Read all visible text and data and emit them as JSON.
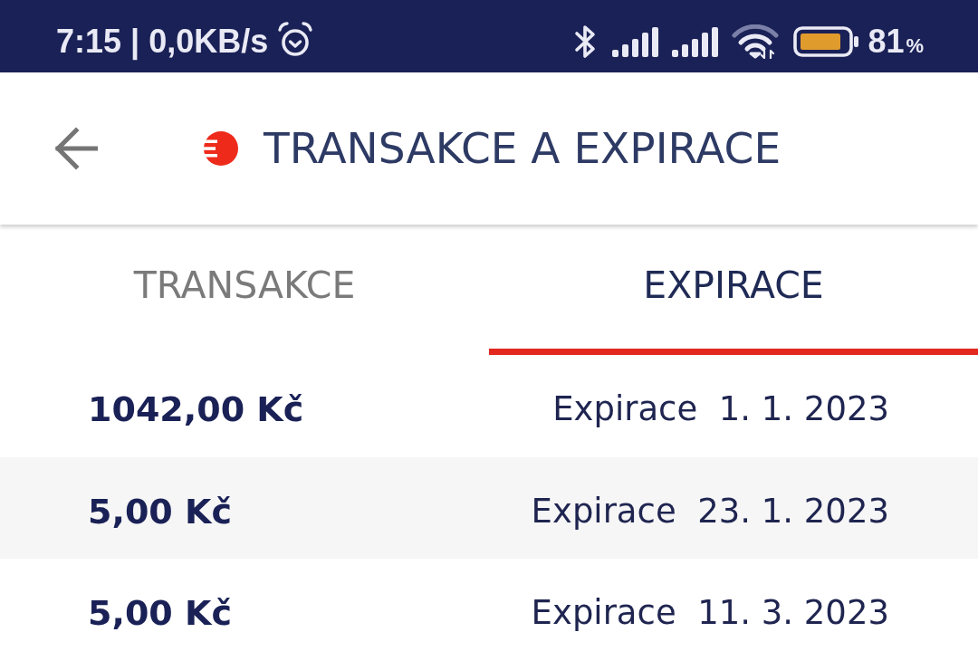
{
  "status_bar": {
    "time_and_speed": "7:15 | 0,0KB/s",
    "battery_percent": "81",
    "battery_unit": "%"
  },
  "app_bar": {
    "title": "TRANSAKCE A EXPIRACE"
  },
  "tabs": [
    {
      "label": "TRANSAKCE",
      "selected": false
    },
    {
      "label": "EXPIRACE",
      "selected": true
    }
  ],
  "rows": [
    {
      "amount": "1042,00 Kč",
      "expiry": "Expirace  1. 1. 2023"
    },
    {
      "amount": "5,00 Kč",
      "expiry": "Expirace  23. 1. 2023"
    },
    {
      "amount": "5,00 Kč",
      "expiry": "Expirace  11. 3. 2023"
    }
  ]
}
